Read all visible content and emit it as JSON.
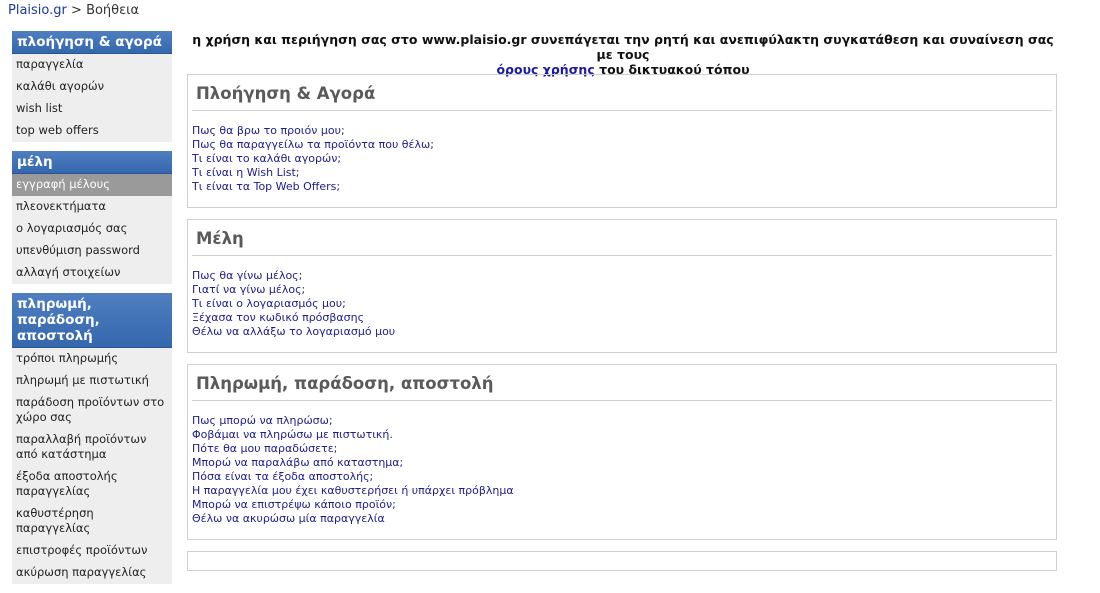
{
  "breadcrumb": {
    "home": "Plaisio.gr",
    "separator": ">",
    "current": "Βοήθεια"
  },
  "sidebar": {
    "groups": [
      {
        "title": "πλοήγηση & αγορά",
        "items": [
          "παραγγελία",
          "καλάθι αγορών",
          "wish list",
          "top web offers"
        ]
      },
      {
        "title": "μέλη",
        "items": [
          "εγγραφή μέλους",
          "πλεονεκτήματα",
          "ο λογαριασμός σας",
          "υπενθύμιση password",
          "αλλαγή στοιχείων"
        ]
      },
      {
        "title": "πληρωμή, παράδοση, αποστολή",
        "items": [
          "τρόποι πληρωμής",
          "πληρωμή με πιστωτική",
          "παράδοση προϊόντων στο χώρο σας",
          "παραλλαβή προϊόντων από κατάστημα",
          "έξοδα αποστολής παραγγελίας",
          "καθυστέρηση παραγγελίας",
          "επιστροφές προϊόντων",
          "ακύρωση παραγγελίας"
        ]
      }
    ]
  },
  "notice": {
    "text_before": "η χρήση και περιήγηση σας στο www.plaisio.gr συνεπάγεται την ρητή και ανεπιφύλακτη συγκατάθεση και συναίνεση σας με τους",
    "link": "όρους χρήσης",
    "text_after": "του δικτυακού τόπου"
  },
  "sections": [
    {
      "title": "Πλοήγηση & Αγορά",
      "questions": [
        "Πως θα βρω το προιόν μου;",
        "Πως θα παραγγείλω τα προϊόντα που θέλω;",
        "Τι είναι το καλάθι αγορών;",
        "Τι είναι η Wish List;",
        "Τι είναι τα Top Web Offers;"
      ]
    },
    {
      "title": "Μέλη",
      "questions": [
        "Πως θα γίνω μέλος;",
        "Γιατί να γίνω μέλος;",
        "Τι είναι ο λογαριασμός μου;",
        "Ξέχασα τον κωδικό πρόσβασης",
        "Θέλω να αλλάξω το λογαριασμό μου"
      ]
    },
    {
      "title": "Πληρωμή, παράδοση, αποστολή",
      "questions": [
        "Πως μπορώ να πληρώσω;",
        "Φοβάμαι να πληρώσω με πιστωτική.",
        "Πότε θα μου παραδώσετε;",
        "Μπορώ να παραλάβω από καταστημα;",
        "Πόσα είναι τα έξοδα αποστολής;",
        "Η παραγγελία μου έχει καθυστερήσει ή υπάρχει πρόβλημα",
        "Μπορώ να επιστρέψω κάποιο προϊόν;",
        "Θέλω να ακυρώσω μία παραγγελία"
      ]
    }
  ]
}
